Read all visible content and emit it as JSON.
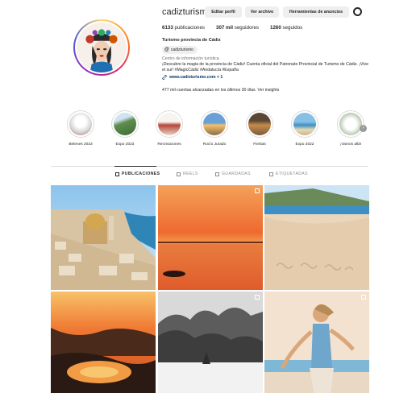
{
  "profile": {
    "username": "cadizturismo",
    "buttons": {
      "edit": "Editar perfil",
      "archive": "Ver archivo",
      "ads": "Herramientas de anuncios"
    },
    "stats": {
      "posts_count": "6133",
      "posts_label": "publicaciones",
      "followers_count": "307 mil",
      "followers_label": "seguidores",
      "following_count": "1260",
      "following_label": "seguidos"
    },
    "name": "Turismo provincia de Cádiz",
    "threads_handle": "cadizturismo",
    "category": "Centro de información turística",
    "bio": "¡Descubre la magia de la provincia de Cádiz! Cuenta oficial del Patronato Provincial de Turismo de Cádiz. ¡Vive el sur! #MagicCádiz #Andalucía #España",
    "link": "www.cadizturismo.com + 1",
    "insights": "477 mil cuentas alcanzadas en los últimos 30 días. Ver insights"
  },
  "highlights": [
    {
      "label": "Belenes 2023"
    },
    {
      "label": "Expo 2023"
    },
    {
      "label": "Recreaciones"
    },
    {
      "label": "Rocío Jurado"
    },
    {
      "label": "Fiestas"
    },
    {
      "label": "Expo 2022"
    },
    {
      "label": "¡Vamos allá!"
    }
  ],
  "tabs": {
    "posts": "PUBLICACIONES",
    "reels": "REELS",
    "saved": "GUARDADAS",
    "tagged": "ETIQUETADAS"
  },
  "icons": {
    "settings": "gear-icon",
    "threads": "threads-icon",
    "link": "link-icon",
    "next": "chevron-right-icon",
    "grid": "grid-icon",
    "reels": "reels-icon",
    "saved": "bookmark-icon",
    "tagged": "tag-icon"
  },
  "colors": {
    "text": "#262626",
    "muted": "#737373",
    "link": "#00376b",
    "button_bg": "#efefef",
    "border": "#dbdbdb"
  }
}
